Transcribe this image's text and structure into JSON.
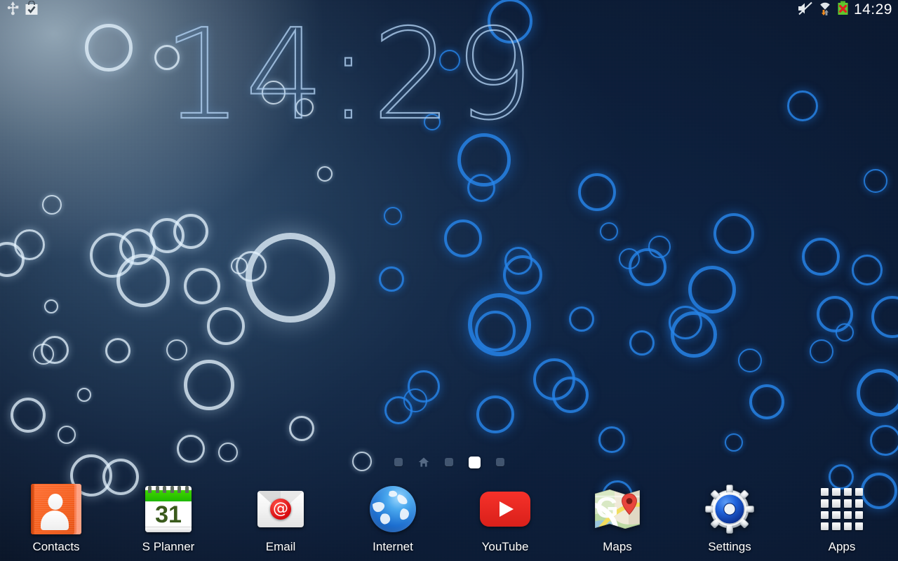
{
  "statusbar": {
    "time": "14:29",
    "left_icons": [
      {
        "name": "usb-icon",
        "label": "USB connected"
      },
      {
        "name": "play-store-update-icon",
        "label": "Play Store update available"
      }
    ],
    "right_icons": [
      {
        "name": "mute-icon",
        "label": "Sound muted"
      },
      {
        "name": "wifi-icon",
        "label": "Wi-Fi connected, data activity"
      },
      {
        "name": "battery-error-icon",
        "label": "Battery not charging"
      }
    ]
  },
  "clock_widget": {
    "time": "14:29"
  },
  "page_indicator": {
    "count": 5,
    "active_index": 3,
    "home_index": 1,
    "pages": [
      "page-1",
      "home-page",
      "page-3",
      "page-4",
      "page-5"
    ]
  },
  "dock": {
    "apps": [
      {
        "label": "Contacts",
        "icon": "contacts-icon"
      },
      {
        "label": "S Planner",
        "icon": "s-planner-icon",
        "day": "31"
      },
      {
        "label": "Email",
        "icon": "email-icon",
        "glyph": "@"
      },
      {
        "label": "Internet",
        "icon": "internet-globe-icon"
      },
      {
        "label": "YouTube",
        "icon": "youtube-icon"
      },
      {
        "label": "Maps",
        "icon": "maps-icon",
        "glyph": "G"
      },
      {
        "label": "Settings",
        "icon": "settings-gear-icon"
      },
      {
        "label": "Apps",
        "icon": "apps-grid-icon"
      }
    ]
  },
  "colors": {
    "accent_blue": "#1a7ae0",
    "wallpaper_dark": "#04112a",
    "wallpaper_light": "#8a99a6",
    "contacts_orange": "#f4601f",
    "planner_green": "#2fc500",
    "email_red": "#d70b10",
    "youtube_red": "#e0211b",
    "settings_blue": "#1250c8",
    "label_white": "#ffffff"
  }
}
